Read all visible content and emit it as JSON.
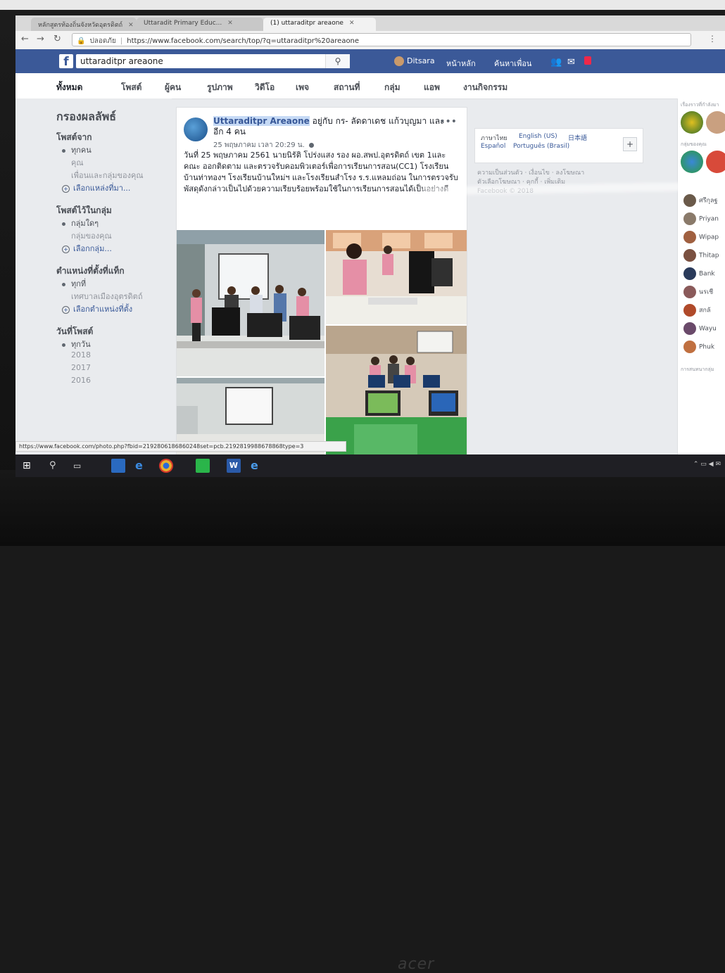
{
  "browser": {
    "tabs": [
      {
        "label": "หลักสูตรท้องถิ่นจังหวัดอุตรดิตถ์"
      },
      {
        "label": "Uttaradit Primary Educ..."
      },
      {
        "label": "(1) uttaraditpr areaone"
      }
    ],
    "security_label": "ปลอดภัย",
    "url": "https://www.facebook.com/search/top/?q=uttaraditpr%20areaone",
    "status_url": "https://www.facebook.com/photo.php?fbid=2192806186860248set=pcb.2192819988678868type=3"
  },
  "fb": {
    "logo": "f",
    "search_value": "uttaraditpr areaone",
    "user_name": "Ditsara",
    "nav_home": "หน้าหลัก",
    "nav_find_friends": "ค้นหาเพื่อน"
  },
  "filters": [
    "ทั้งหมด",
    "โพสต์",
    "ผู้คน",
    "รูปภาพ",
    "วิดีโอ",
    "เพจ",
    "สถานที่",
    "กลุ่ม",
    "แอพ",
    "งานกิจกรรม"
  ],
  "sidebar": {
    "title": "กรองผลลัพธ์",
    "sections": [
      {
        "heading": "โพสต์จาก",
        "options": [
          "ทุกคน",
          "คุณ",
          "เพื่อนและกลุ่มของคุณ",
          "เลือกแหล่งที่มา..."
        ]
      },
      {
        "heading": "โพสต์ไว้ในกลุ่ม",
        "options": [
          "กลุ่มใดๆ",
          "กลุ่มของคุณ",
          "เลือกกลุ่ม..."
        ]
      },
      {
        "heading": "ตำแหน่งที่ตั้งที่แท็ก",
        "options": [
          "ทุกที่",
          "เทศบาลเมืองอุตรดิตถ์",
          "เลือกตำแหน่งที่ตั้ง"
        ]
      },
      {
        "heading": "วันที่โพสต์",
        "options": [
          "ทุกวัน",
          "2018",
          "2017",
          "2016"
        ]
      }
    ]
  },
  "post": {
    "author": "Uttaraditpr Areaone",
    "with_text": "อยู่กับ กร- ลัดดาเดช แก้วบุญมา และอีก 4 คน",
    "time": "25 พฤษภาคม เวลา 20:29 น.",
    "body": "วันที่ 25 พฤษภาคม 2561 นายนิรัติ โปร่งแสง รอง ผอ.สพป.อุตรดิตถ์ เขต 1และคณะ ออกติดตาม และตรวจรับคอมพิวเตอร์เพื่อการเรียนการสอน(CC1) โรงเรียนบ้านท่าทองฯ โรงเรียนบ้านใหม่ฯ และโรงเรียนสำโรง ร.ร.แหลมถ่อน ในการตรวจรับพัสดุดังกล่าวเป็นไปด้วยความเรียบร้อยพร้อมใช้ในการเรียนการสอนได้เป็นอย่างดี"
  },
  "right": {
    "languages": [
      "ภาษาไทย",
      "English (US)",
      "日本語",
      "Español",
      "Português (Brasil)"
    ],
    "footer_line1": "ความเป็นส่วนตัว · เงื่อนไข · ลงโฆษณา",
    "footer_line2": "ตัวเลือกโฆษณา · คุกกี้ · เพิ่มเติม",
    "copyright": "Facebook © 2018"
  },
  "chat": {
    "stories_heading": "เรื่องราวที่กำลังมา",
    "groups_heading": "กลุ่มของคุณ",
    "contacts": [
      "ศรีกุลฐ",
      "Priyan",
      "Wipap",
      "Thitap",
      "Bank",
      "นรเชี",
      "สกลั",
      "Wayu",
      "Phuk"
    ],
    "more_heading": "การสนทนากลุ่ม"
  },
  "monitor_brand": "acer"
}
